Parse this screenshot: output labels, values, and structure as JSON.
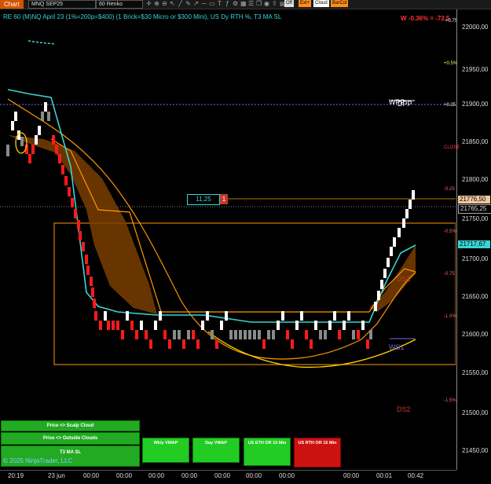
{
  "toolbar": {
    "chart_tab": "Chart",
    "instrument": "MNQ SEP25",
    "timeframe": "60 Renko",
    "pills": [
      {
        "label": "Off",
        "color": "#dddddd"
      },
      {
        "label": "Ext+",
        "color": "#ff8c1a"
      },
      {
        "label": "Cloud",
        "color": "#ffffff"
      },
      {
        "label": "BarCol",
        "color": "#ff8c1a"
      }
    ]
  },
  "chart_header": {
    "title": "RE 60 (M)NQ April 23 (1%=200p=$400) (1 Brick=$30 Micro or $300 Mini), US Dy RTH %, T3 MA SL",
    "pnl": "W -0.36% = -72.5"
  },
  "price_axis": {
    "ticks": [
      "22000,00",
      "21950,00",
      "21900,00",
      "21850,00",
      "21800,00",
      "21750,00",
      "21700,00",
      "21650,00",
      "21600,00",
      "21550,00",
      "21500,00",
      "21450,00"
    ],
    "current_price": "21776,50",
    "level_2": "21765,25",
    "level_3": "21717,67"
  },
  "pct_labels": [
    {
      "label": "+0.75",
      "color": "#ffffff"
    },
    {
      "label": "+0.5%",
      "color": "#ffff66"
    },
    {
      "label": "+0.25",
      "color": "#ffffff"
    },
    {
      "label": "CLOSE",
      "color": "#ff3333"
    },
    {
      "label": "-0.25",
      "color": "#ff6666"
    },
    {
      "label": "-0.5%",
      "color": "#ff6666"
    },
    {
      "label": "-0.75",
      "color": "#ff6666"
    },
    {
      "label": "-1.0%",
      "color": "#ff6666"
    },
    {
      "label": "-1.5%",
      "color": "#ff6666"
    }
  ],
  "levels": {
    "wpp": "WPP",
    "dpp": "DPP",
    "ds1": "DS1",
    "ws1": "WS1",
    "ds2": "DS2"
  },
  "time_axis": [
    "20:19",
    "23 jun",
    "00:00",
    "00:00",
    "00:00",
    "00:00",
    "00:00",
    "00:00",
    "00:00",
    "00:00",
    "00:01",
    "00:42"
  ],
  "trade_box": {
    "ticks": "11,25",
    "qty": "1"
  },
  "panels": {
    "scalp_cloud": "Price <> Scalp Cloud",
    "outside_clouds": "Price <> Outside Clouds",
    "t3_ma_sl": "T3 MA SL",
    "wkly_vwap": "Wkly VWAP",
    "day_vwap": "Day VWAP",
    "us_eth_or": "US ETH OR 15 Min",
    "us_rth_or": "US RTH OR 15 Min"
  },
  "copyright": "© 2025 NinjaTrader, LLC",
  "colors": {
    "up_brick": "#ffffff",
    "down_brick": "#ff1a1a",
    "neutral_brick": "#8a8a8a",
    "cyan_ma": "#3bd4d4",
    "orange_band": "#ff9900",
    "yellow_curve": "#ffcc00",
    "range_box": "#ff9900",
    "green_panel": "#22aa22",
    "red_panel": "#cc1111"
  }
}
